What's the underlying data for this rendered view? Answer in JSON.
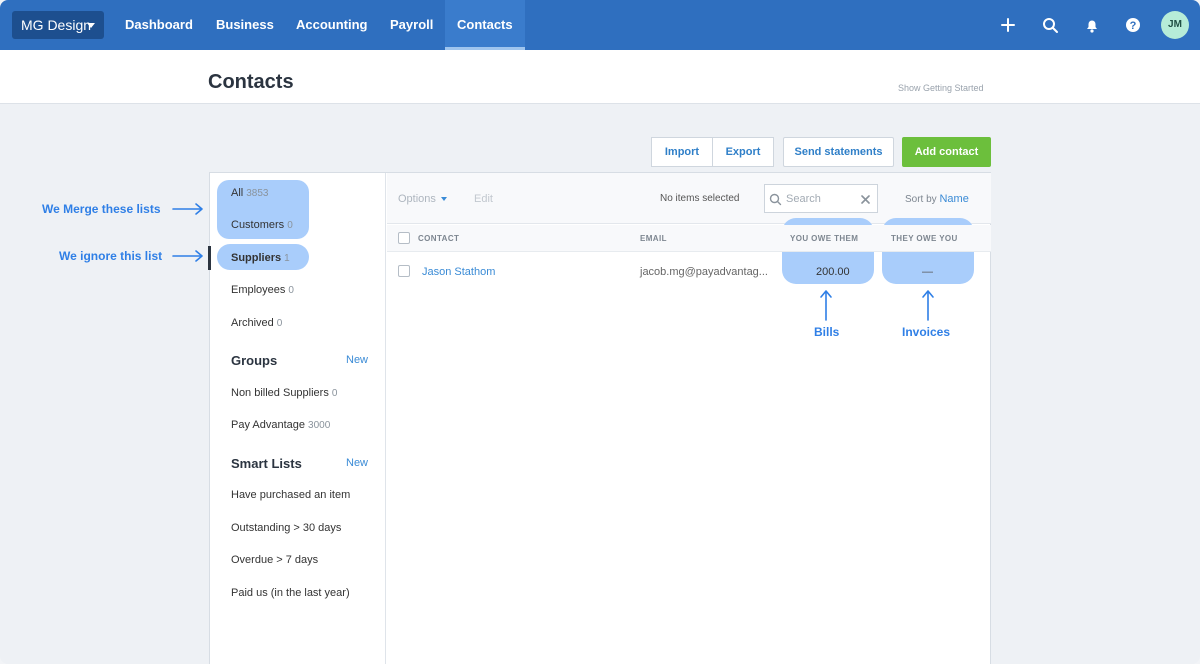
{
  "nav": {
    "org": "MG Design",
    "items": [
      "Dashboard",
      "Business",
      "Accounting",
      "Payroll",
      "Contacts"
    ],
    "avatar": "JM"
  },
  "header": {
    "title": "Contacts",
    "getting_started": "Show Getting Started"
  },
  "actions": {
    "import": "Import",
    "export": "Export",
    "send_statements": "Send statements",
    "add_contact": "Add contact"
  },
  "sidebar": {
    "lists": [
      {
        "label": "All",
        "count": "3853"
      },
      {
        "label": "Customers",
        "count": "0"
      },
      {
        "label": "Suppliers",
        "count": "1"
      },
      {
        "label": "Employees",
        "count": "0"
      },
      {
        "label": "Archived",
        "count": "0"
      }
    ],
    "groups_title": "Groups",
    "groups_new": "New",
    "groups": [
      {
        "label": "Non billed Suppliers",
        "count": "0"
      },
      {
        "label": "Pay Advantage",
        "count": "3000"
      }
    ],
    "smart_title": "Smart Lists",
    "smart_new": "New",
    "smart": [
      "Have purchased an item",
      "Outstanding > 30 days",
      "Overdue > 7 days",
      "Paid us (in the last year)"
    ]
  },
  "toolbar": {
    "options": "Options",
    "edit": "Edit",
    "selected": "No items selected",
    "search_placeholder": "Search",
    "sort_label": "Sort by",
    "sort_value": "Name"
  },
  "table": {
    "columns": [
      "CONTACT",
      "EMAIL",
      "YOU OWE THEM",
      "THEY OWE YOU"
    ],
    "rows": [
      {
        "contact": "Jason Stathom",
        "email": "jacob.mg@payadvantag...",
        "you_owe": "200.00",
        "they_owe": "—"
      }
    ]
  },
  "annotations": {
    "merge": "We Merge these lists",
    "ignore": "We ignore this list",
    "bills": "Bills",
    "invoices": "Invoices"
  },
  "colors": {
    "nav": "#2f6fbf",
    "highlight": "#a9cdfb",
    "annotation": "#2f7fe6",
    "add_button": "#6cbf3c",
    "link": "#3a8bd6"
  }
}
